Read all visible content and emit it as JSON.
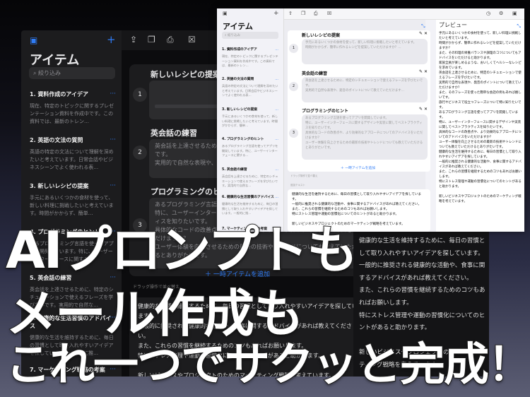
{
  "app": {
    "title": "アイテム",
    "search_placeholder": "絞り込み",
    "preview_title": "プレビュー"
  },
  "items": [
    {
      "title": "1. 資料作成のアイデア",
      "preview": "現在、特定のトピックに関するプレゼンテーション資料を作成中です。この資料では、最新のトレン…"
    },
    {
      "title": "2. 英語の文法の質問",
      "preview": "英語の特定の文法について理解を深めたいと考えています。日常会話やビジネスシーンでよく使われる表…"
    },
    {
      "title": "3. 新しいレシピの提案",
      "preview": "手元にあるいくつかの食材を使って、新しい料理に挑戦したいと考えています。時間がかからず、簡単…"
    },
    {
      "title": "4. プログラミングのヒント",
      "preview": "あるプログラミング言語を使ってアプリを開発しています。特に、ユーザーインターフェースに関する…"
    },
    {
      "title": "5. 英会話の練習",
      "preview": "英会話を上達させるために、特定のシチュエーションで使えるフレーズを学びたいです。実用的で自然な…"
    },
    {
      "title": "6. 健康的な生活習慣のアドバイス",
      "preview": "健康的な生活を維持するために、毎日の習慣として取り入れやすいアイデアを探しています。一般的に推…"
    },
    {
      "title": "7. マーケティング戦略の考案",
      "preview": ""
    }
  ],
  "cards": [
    {
      "num": "1",
      "title": "新しいレシピの提案",
      "body": "手元にあるいくつかの食材を使って、新しい料理に挑戦したいと考えています。\n時間がかからず、簡単に作れるレシピを提案していただけますか？…"
    },
    {
      "num": "2",
      "title": "英会話の練習",
      "body": "英会話を上達させるために、特定のシチュエーションで使えるフレーズを学びたいです。\n実用的で自然な表現や、発音のポイントについて教えていただけます…"
    },
    {
      "num": "3",
      "title": "プログラミングのヒント",
      "body": "あるプログラミング言語を使ってアプリを開発しています。\n特に、ユーザーインターフェースに関するデザインや実装に関してベストプラクティスを知りたいです。\n具体的なコードの改善点や、より効果的なアプローチについてのアドバイスをいただけますか？\nユーザー体験を向上させるための最新の技術やトレンドについても教えていただけるとありがたいです。"
    }
  ],
  "add_label": "一時アイテムを追加",
  "drag_hint": "ドラッグ操作で並べ替え",
  "extra_label": "追加テキスト",
  "extra_text": "健康的な生活を維持するために、毎日の習慣として取り入れやすいアイデアを探しています。\n一般的に推奨される健康的な活動や、食事に関するアドバイスがあれば教えてください。\nまた、これらの習慣を継続するためのコツもあればお願いします。\n特にストレス管理や運動の習慣化についてのヒントがあると助かります。\n\n新しいビジネスやプロジェクトのためのマーケティング戦略を考えています。",
  "preview_text": "手元にあるいくつかの食材を使って、新しい料理に挑戦したいと考えています。\n時間がかからず、簡単に作れるレシピを提案していただけますか？\nまた、その料理の栄養バランスや調理のコツについてもアドバイスをいただけると助かります。\n家族全員が楽しめるような、おいしくてヘルシーなレシピを求めています。\n英会話を上達させるために、特定のシチュエーションで使えるフレーズを学びたいです。\n実用的で自然な表現や、発音のポイントについて教えていただけますか？\nまた、そのフレーズを使った簡単な会話の例もあれば嬉しいです。\n旅行やビジネスで役立つフレーズについて特に知りたいです。\nあるプログラミング言語を使ってアプリを開発しています。\n特に、ユーザーインターフェースに関するデザインや実装に関してベストプラクティスを知りたいです。\n具体的なコードの改善点や、より効果的なアプローチについてのアドバイスをいただけますか？\nユーザー体験を向上させるための最新の技術やトレンドについても教えていただけるとありがたいです。\n健康的な生活を維持するために、毎日の習慣として取り入れやすいアイデアを探しています。\n一般的に推奨される健康的な活動や、食事に関するアドバイスがあれば教えてください。\nまた、これらの習慣を継続するためのコツもあればお願いします。\n特にストレス管理や運動の習慣化についてのヒントがあると助かります。\n\n新しいビジネスやプロジェクトのためのマーケティング戦略を考えています。",
  "promo": {
    "line1": "AIプロンプトも",
    "line2": "メール作成も",
    "line3": "これ一つでサクッと完成！"
  },
  "icons": [
    "sidebar-toggle-icon",
    "plus-icon",
    "share-icon",
    "copy-icon",
    "import-icon",
    "clear-icon",
    "history-icon",
    "gear-icon",
    "inspector-icon",
    "collapse-icon"
  ]
}
